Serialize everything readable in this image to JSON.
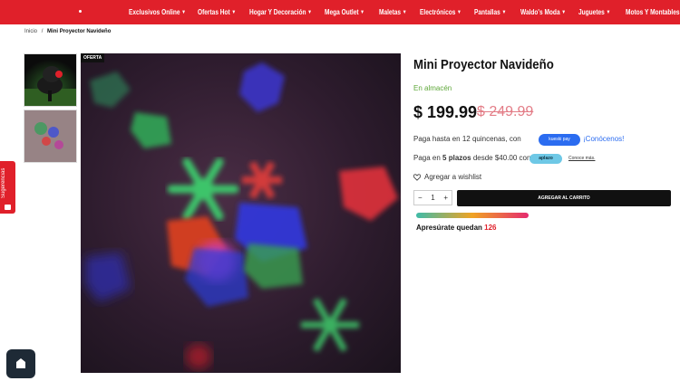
{
  "nav": {
    "items": [
      "Exclusivos Online",
      "Ofertas Hot",
      "Hogar Y Decoración",
      "Mega Outlet",
      "Maletas",
      "Electrónicos",
      "Pantallas",
      "Waldo's Moda",
      "Juguetes",
      "Motos Y Montables"
    ]
  },
  "breadcrumb": {
    "home": "Inicio",
    "separator": "/",
    "current": "Mini Proyector Navideño"
  },
  "side_tab": {
    "label": "Sugerencias"
  },
  "image": {
    "badge": "OFERTA"
  },
  "product": {
    "title": "Mini Proyector Navideño",
    "stock": "En almacén",
    "price": "$ 199.99",
    "old_price": "$ 249.99",
    "kueski_text": "Paga hasta en 12 quincenas, con",
    "kueski_pill": "kueski pay",
    "kueski_link": "¡Conócenos!",
    "aplazo_text_pre": "Paga en ",
    "aplazo_text_bold": "5 plazos",
    "aplazo_text_post": " desde $40.00 con",
    "aplazo_pill": "aplazo",
    "aplazo_link": "Conoce más.",
    "wishlist": "Agregar a wishlist",
    "qty_minus": "−",
    "qty_value": "1",
    "qty_plus": "+",
    "cart_button": "AGREGAR AL CARRITO",
    "hurry_text": "Apresúrate quedan",
    "hurry_qty": "126",
    "stock_fraction": 1.0
  },
  "colors": {
    "brand_red": "#e0202a",
    "stock_green": "#5fa83a",
    "old_price_pink": "#e37d87",
    "link_blue": "#2b6cf0",
    "aplazo_blue": "#6ec8e6",
    "cart_black": "#111111"
  },
  "icons": {
    "chevron": "chevron-down-icon",
    "heart": "heart-icon",
    "home": "home-icon",
    "chat": "chat-icon",
    "snowflake": "snowflake-icon"
  }
}
